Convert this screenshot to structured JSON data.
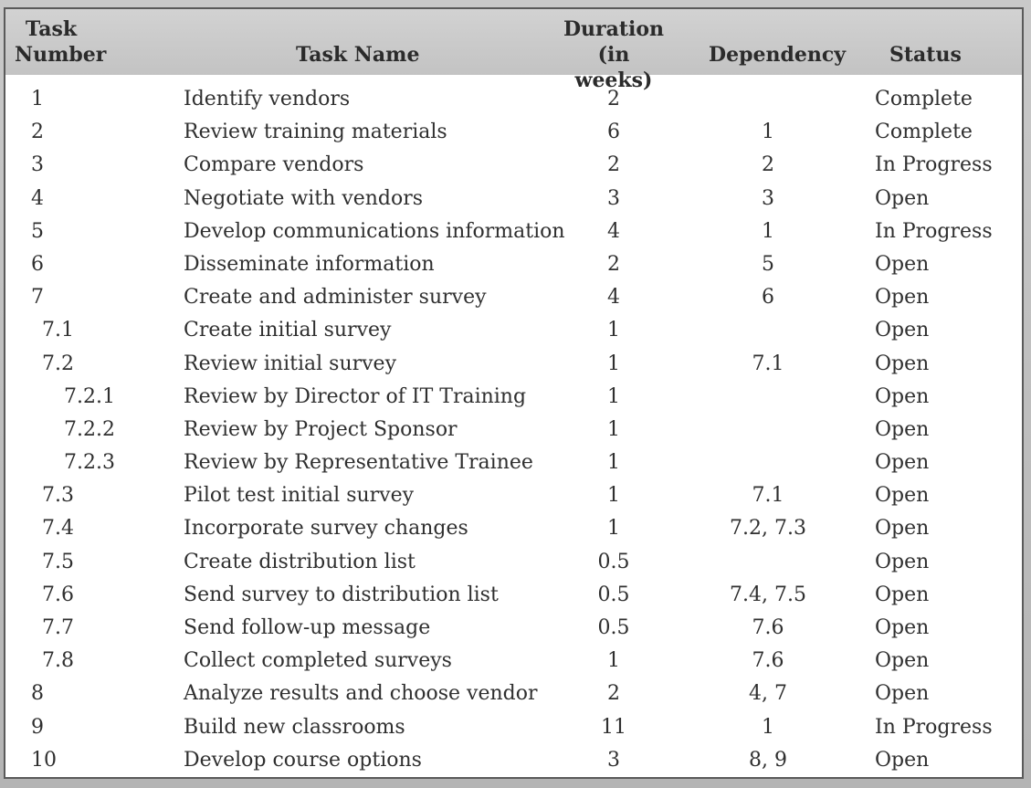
{
  "table": {
    "headers": {
      "number": "Task\nNumber",
      "name": "Task Name",
      "duration": "Duration\n(in weeks)",
      "dependency": "Dependency",
      "status": "Status"
    },
    "rows": [
      {
        "number": "1",
        "level": 0,
        "name": "Identify vendors",
        "duration": "2",
        "dependency": "",
        "status": "Complete"
      },
      {
        "number": "2",
        "level": 0,
        "name": "Review training materials",
        "duration": "6",
        "dependency": "1",
        "status": "Complete"
      },
      {
        "number": "3",
        "level": 0,
        "name": "Compare vendors",
        "duration": "2",
        "dependency": "2",
        "status": "In Progress"
      },
      {
        "number": "4",
        "level": 0,
        "name": "Negotiate with vendors",
        "duration": "3",
        "dependency": "3",
        "status": "Open"
      },
      {
        "number": "5",
        "level": 0,
        "name": "Develop communications information",
        "duration": "4",
        "dependency": "1",
        "status": "In Progress"
      },
      {
        "number": "6",
        "level": 0,
        "name": "Disseminate information",
        "duration": "2",
        "dependency": "5",
        "status": "Open"
      },
      {
        "number": "7",
        "level": 0,
        "name": "Create and administer survey",
        "duration": "4",
        "dependency": "6",
        "status": "Open"
      },
      {
        "number": "7.1",
        "level": 1,
        "name": "Create initial survey",
        "duration": "1",
        "dependency": "",
        "status": "Open"
      },
      {
        "number": "7.2",
        "level": 1,
        "name": "Review initial survey",
        "duration": "1",
        "dependency": "7.1",
        "status": "Open"
      },
      {
        "number": "7.2.1",
        "level": 2,
        "name": "Review by Director of IT Training",
        "duration": "1",
        "dependency": "",
        "status": "Open"
      },
      {
        "number": "7.2.2",
        "level": 2,
        "name": "Review by Project Sponsor",
        "duration": "1",
        "dependency": "",
        "status": "Open"
      },
      {
        "number": "7.2.3",
        "level": 2,
        "name": "Review by Representative Trainee",
        "duration": "1",
        "dependency": "",
        "status": "Open"
      },
      {
        "number": "7.3",
        "level": 1,
        "name": "Pilot test initial survey",
        "duration": "1",
        "dependency": "7.1",
        "status": "Open"
      },
      {
        "number": "7.4",
        "level": 1,
        "name": "Incorporate survey changes",
        "duration": "1",
        "dependency": "7.2, 7.3",
        "status": "Open"
      },
      {
        "number": "7.5",
        "level": 1,
        "name": "Create distribution list",
        "duration": "0.5",
        "dependency": "",
        "status": "Open"
      },
      {
        "number": "7.6",
        "level": 1,
        "name": "Send survey to distribution list",
        "duration": "0.5",
        "dependency": "7.4, 7.5",
        "status": "Open"
      },
      {
        "number": "7.7",
        "level": 1,
        "name": "Send follow-up message",
        "duration": "0.5",
        "dependency": "7.6",
        "status": "Open"
      },
      {
        "number": "7.8",
        "level": 1,
        "name": "Collect completed surveys",
        "duration": "1",
        "dependency": "7.6",
        "status": "Open"
      },
      {
        "number": "8",
        "level": 0,
        "name": "Analyze results and choose vendor",
        "duration": "2",
        "dependency": "4, 7",
        "status": "Open"
      },
      {
        "number": "9",
        "level": 0,
        "name": "Build new classrooms",
        "duration": "11",
        "dependency": "1",
        "status": "In Progress"
      },
      {
        "number": "10",
        "level": 0,
        "name": "Develop course options",
        "duration": "3",
        "dependency": "8, 9",
        "status": "Open"
      }
    ]
  }
}
